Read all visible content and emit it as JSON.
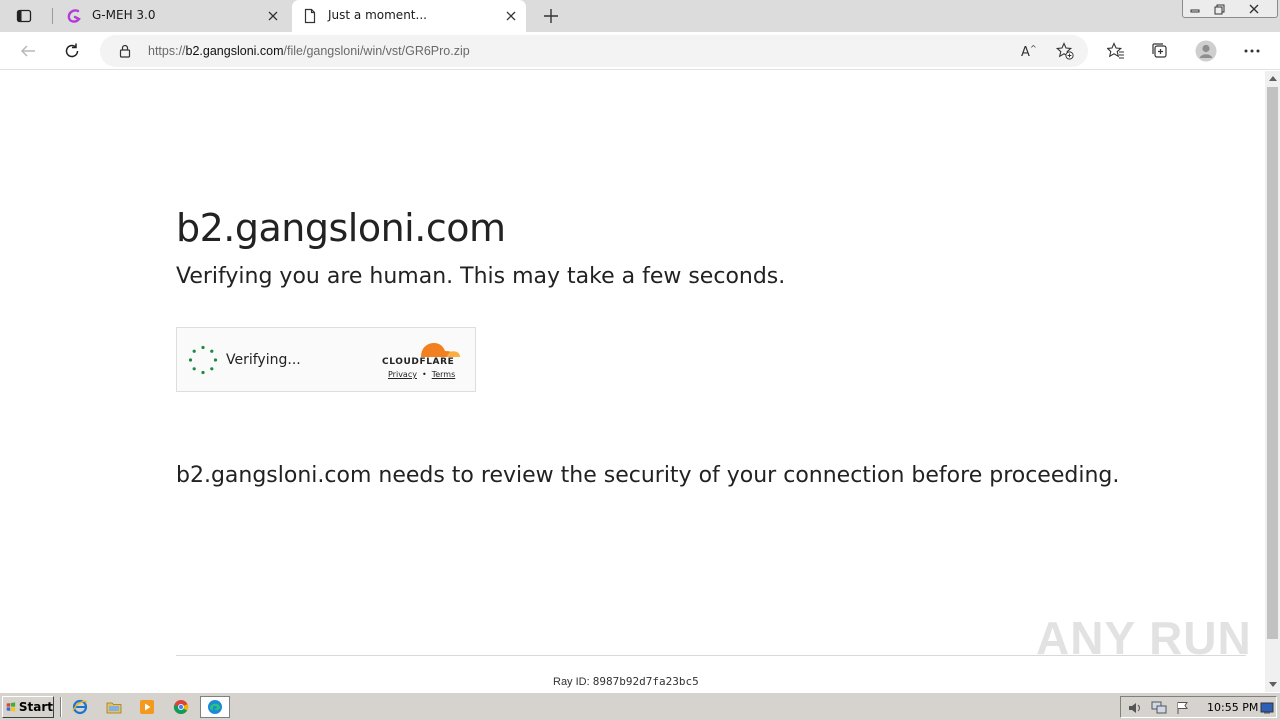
{
  "browser": {
    "tabs": [
      {
        "title": "G-MEH 3.0",
        "active": false,
        "icon": "gmeh-favicon-icon"
      },
      {
        "title": "Just a moment...",
        "active": true,
        "icon": "page-document-icon"
      }
    ],
    "address": {
      "scheme": "https://",
      "host": "b2.gangsloni.com",
      "path": "/file/gangsloni/win/vst/GR6Pro.zip"
    },
    "toolbar_icons": [
      "back-icon",
      "refresh-icon",
      "lock-icon",
      "read-aloud-icon",
      "add-favorite-icon",
      "favorites-icon",
      "collections-icon",
      "profile-avatar-icon",
      "more-menu-icon"
    ]
  },
  "page": {
    "site": "b2.gangsloni.com",
    "subtitle": "Verifying you are human. This may take a few seconds.",
    "widget": {
      "status": "Verifying...",
      "brand": "CLOUDFLARE",
      "privacy": "Privacy",
      "separator": "•",
      "terms": "Terms",
      "brand_color": "#f38020"
    },
    "security_message": "b2.gangsloni.com needs to review the security of your connection before proceeding.",
    "ray_label": "Ray ID:",
    "ray_id": "8987b92d7fa23bc5",
    "watermark": "ANY RUN"
  },
  "taskbar": {
    "start_label": "Start",
    "quick_launch": [
      "ie-icon",
      "folder-icon",
      "media-player-icon",
      "chrome-icon",
      "edge-icon"
    ],
    "clock": "10:55 PM"
  }
}
